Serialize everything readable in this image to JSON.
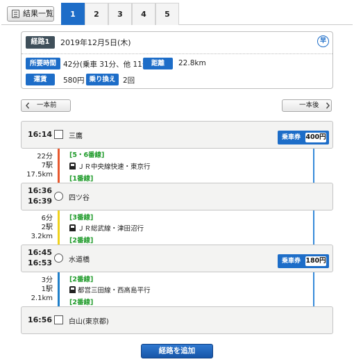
{
  "header": {
    "list_label": "結果一覧",
    "tabs": [
      "1",
      "2",
      "3",
      "4",
      "5"
    ],
    "active_tab": "1"
  },
  "summary": {
    "route_label": "経路1",
    "date": "2019年12月5日(木)",
    "early_icon": "早",
    "time_label": "所要時間",
    "time_value": "42分(乗車 31分、他 11分)",
    "distance_label": "距離",
    "distance_value": "22.8km",
    "fare_label": "運賃",
    "fare_value": "580円",
    "transfer_label": "乗り換え",
    "transfer_value": "2回"
  },
  "nav": {
    "prev_label": "一本前",
    "next_label": "一本後"
  },
  "stations": [
    {
      "time1": "16:14",
      "time2": "",
      "name": "三鷹",
      "marker": "square",
      "fare_label": "乗車券",
      "fare_amount": "400円"
    },
    {
      "time1": "16:36",
      "time2": "16:39",
      "name": "四ツ谷",
      "marker": "circle",
      "fare_label": "",
      "fare_amount": ""
    },
    {
      "time1": "16:45",
      "time2": "16:53",
      "name": "水道橋",
      "marker": "circle",
      "fare_label": "乗車券",
      "fare_amount": "180円"
    },
    {
      "time1": "16:56",
      "time2": "",
      "name": "白山(東京都)",
      "marker": "square",
      "fare_label": "",
      "fare_amount": ""
    }
  ],
  "segments": [
    {
      "duration": "22分",
      "stops": "7駅",
      "distance": "17.5km",
      "platform_from": "[5・6番線]",
      "line": "ＪＲ中央線快速・東京行",
      "platform_to": "[1番線]",
      "color": "#e8582e"
    },
    {
      "duration": "6分",
      "stops": "2駅",
      "distance": "3.2km",
      "platform_from": "[3番線]",
      "line": "ＪＲ総武線・津田沼行",
      "platform_to": "[2番線]",
      "color": "#f0d21c"
    },
    {
      "duration": "3分",
      "stops": "1駅",
      "distance": "2.1km",
      "platform_from": "[2番線]",
      "line": "都営三田線・西高島平行",
      "platform_to": "[2番線]",
      "color": "#1f7fc9"
    }
  ],
  "actions": {
    "add_route_label": "経路を追加"
  },
  "colors": {
    "accent": "#1d6dc8",
    "platform": "#1f9b2a",
    "fare_line": "#3589d9"
  }
}
